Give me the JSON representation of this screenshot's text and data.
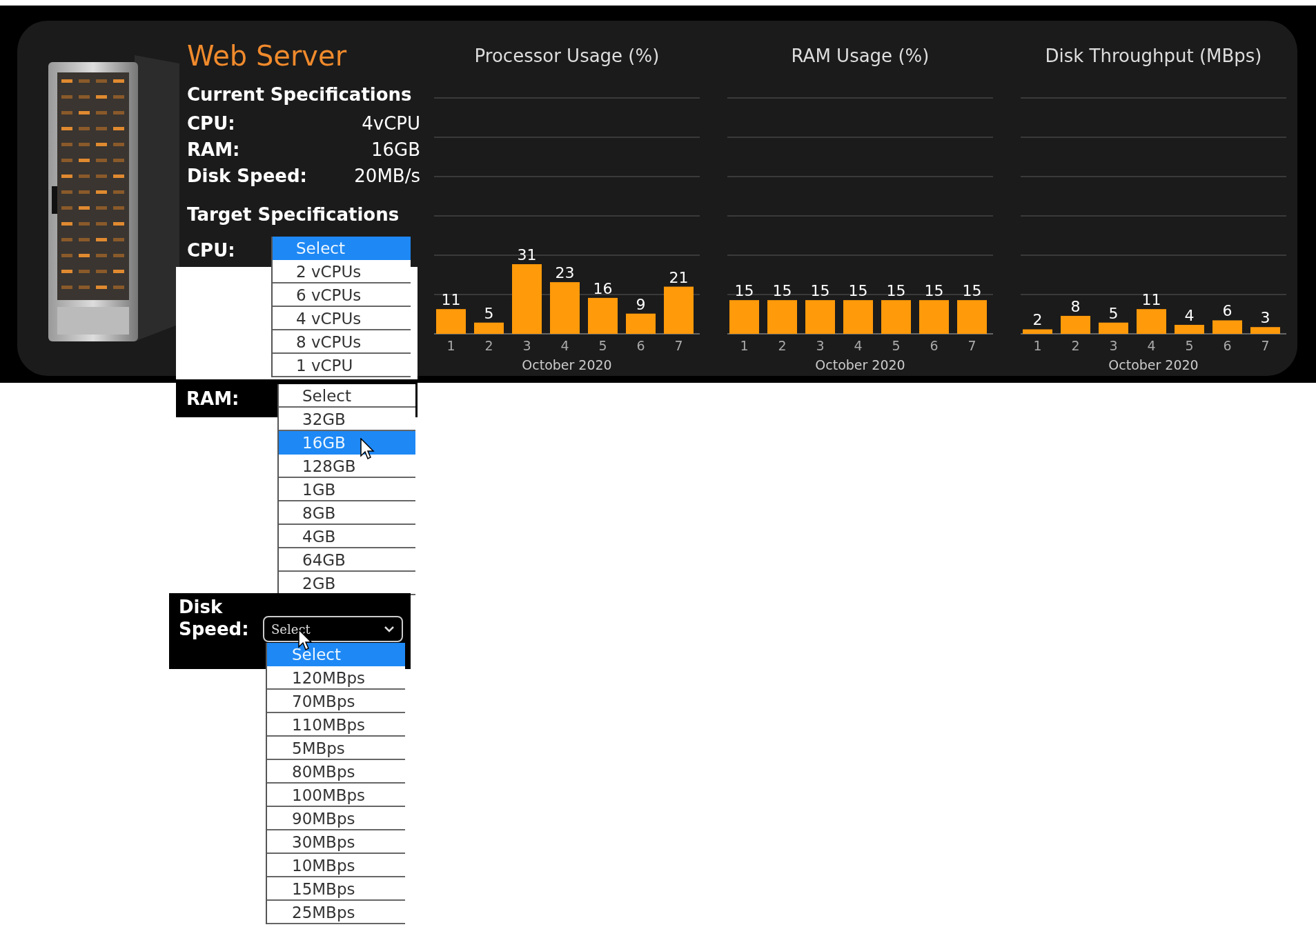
{
  "server": {
    "title": "Web Server",
    "current_heading": "Current Specifications",
    "current": [
      {
        "label": "CPU:",
        "value": "4vCPU"
      },
      {
        "label": "RAM:",
        "value": "16GB"
      },
      {
        "label": "Disk Speed:",
        "value": "20MB/s"
      }
    ],
    "target_heading": "Target Specifications"
  },
  "charts": [
    {
      "chart_data": {
        "type": "bar",
        "title": "Processor Usage (%)",
        "xlabel": "October 2020",
        "categories": [
          "1",
          "2",
          "3",
          "4",
          "5",
          "6",
          "7"
        ],
        "values": [
          11,
          5,
          31,
          23,
          16,
          9,
          21
        ],
        "ylim": [
          0,
          105
        ],
        "data_labels": true
      }
    },
    {
      "chart_data": {
        "type": "bar",
        "title": "RAM Usage (%)",
        "xlabel": "October 2020",
        "categories": [
          "1",
          "2",
          "3",
          "4",
          "5",
          "6",
          "7"
        ],
        "values": [
          15,
          15,
          15,
          15,
          15,
          15,
          15
        ],
        "ylim": [
          0,
          105
        ],
        "data_labels": true
      }
    },
    {
      "chart_data": {
        "type": "bar",
        "title": "Disk Throughput (MBps)",
        "xlabel": "October 2020",
        "categories": [
          "1",
          "2",
          "3",
          "4",
          "5",
          "6",
          "7"
        ],
        "values": [
          2,
          8,
          5,
          11,
          4,
          6,
          3
        ],
        "ylim": [
          0,
          105
        ],
        "data_labels": true
      }
    }
  ],
  "target_fields": [
    {
      "label": "CPU:",
      "options": [
        {
          "text": "Select",
          "selected": true
        },
        {
          "text": "2 vCPUs",
          "selected": false
        },
        {
          "text": "6 vCPUs",
          "selected": false
        },
        {
          "text": "4 vCPUs",
          "selected": false
        },
        {
          "text": "8 vCPUs",
          "selected": false
        },
        {
          "text": "1 vCPU",
          "selected": false
        }
      ]
    },
    {
      "label": "RAM:",
      "options": [
        {
          "text": "Select",
          "selected": false
        },
        {
          "text": "32GB",
          "selected": false
        },
        {
          "text": "16GB",
          "selected": true
        },
        {
          "text": "128GB",
          "selected": false
        },
        {
          "text": "1GB",
          "selected": false
        },
        {
          "text": "8GB",
          "selected": false
        },
        {
          "text": "4GB",
          "selected": false
        },
        {
          "text": "64GB",
          "selected": false
        },
        {
          "text": "2GB",
          "selected": false
        }
      ]
    },
    {
      "label": "Disk Speed:",
      "value": "Select",
      "options": [
        {
          "text": "Select",
          "selected": true
        },
        {
          "text": "120MBps",
          "selected": false
        },
        {
          "text": "70MBps",
          "selected": false
        },
        {
          "text": "110MBps",
          "selected": false
        },
        {
          "text": "5MBps",
          "selected": false
        },
        {
          "text": "80MBps",
          "selected": false
        },
        {
          "text": "100MBps",
          "selected": false
        },
        {
          "text": "90MBps",
          "selected": false
        },
        {
          "text": "30MBps",
          "selected": false
        },
        {
          "text": "10MBps",
          "selected": false
        },
        {
          "text": "15MBps",
          "selected": false
        },
        {
          "text": "25MBps",
          "selected": false
        }
      ]
    }
  ]
}
